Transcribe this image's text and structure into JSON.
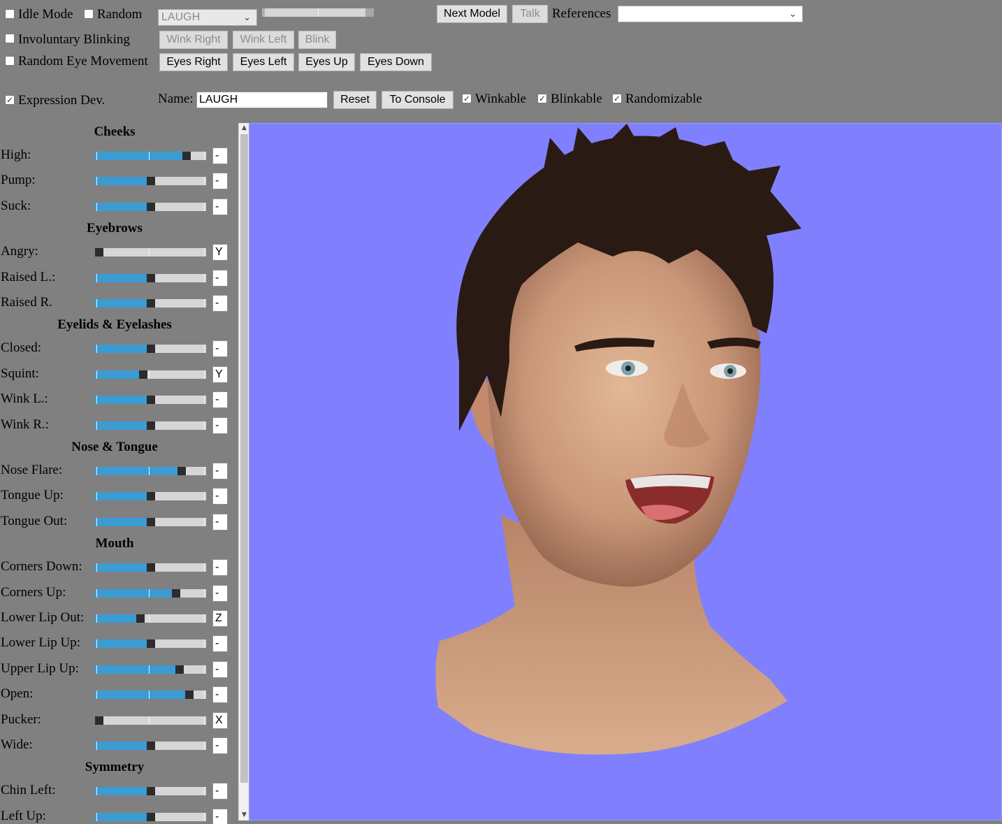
{
  "toolbar": {
    "idle_mode": {
      "label": "Idle Mode",
      "checked": false
    },
    "random": {
      "label": "Random",
      "checked": false
    },
    "expression_select": {
      "value": "LAUGH"
    },
    "next_model": "Next Model",
    "talk": "Talk",
    "references_label": "References",
    "references_value": "",
    "involuntary_blinking": {
      "label": "Involuntary Blinking",
      "checked": false
    },
    "wink_right": "Wink Right",
    "wink_left": "Wink Left",
    "blink": "Blink",
    "random_eye_movement": {
      "label": "Random Eye Movement",
      "checked": false
    },
    "eyes_right": "Eyes Right",
    "eyes_left": "Eyes Left",
    "eyes_up": "Eyes Up",
    "eyes_down": "Eyes Down",
    "expression_dev": {
      "label": "Expression Dev.",
      "checked": true
    },
    "name_label": "Name:",
    "name_value": "LAUGH",
    "reset": "Reset",
    "to_console": "To Console",
    "winkable": {
      "label": "Winkable",
      "checked": true
    },
    "blinkable": {
      "label": "Blinkable",
      "checked": true
    },
    "randomizable": {
      "label": "Randomizable",
      "checked": true
    }
  },
  "sections": [
    {
      "title": "Cheeks",
      "sliders": [
        {
          "label": "High:",
          "value": 0.85,
          "key": "-"
        },
        {
          "label": "Pump:",
          "value": 0.5,
          "key": "-"
        },
        {
          "label": "Suck:",
          "value": 0.5,
          "key": "-"
        }
      ]
    },
    {
      "title": "Eyebrows",
      "sliders": [
        {
          "label": "Angry:",
          "value": 0.0,
          "key": "Y"
        },
        {
          "label": "Raised L.:",
          "value": 0.5,
          "key": "-"
        },
        {
          "label": "Raised R.",
          "value": 0.5,
          "key": "-"
        }
      ]
    },
    {
      "title": "Eyelids & Eyelashes",
      "sliders": [
        {
          "label": "Closed:",
          "value": 0.5,
          "key": "-"
        },
        {
          "label": "Squint:",
          "value": 0.43,
          "key": "Y"
        },
        {
          "label": "Wink L.:",
          "value": 0.5,
          "key": "-"
        },
        {
          "label": "Wink R.:",
          "value": 0.5,
          "key": "-"
        }
      ]
    },
    {
      "title": "Nose & Tongue",
      "sliders": [
        {
          "label": "Nose Flare:",
          "value": 0.8,
          "key": "-"
        },
        {
          "label": "Tongue Up:",
          "value": 0.5,
          "key": "-"
        },
        {
          "label": "Tongue Out:",
          "value": 0.5,
          "key": "-"
        }
      ]
    },
    {
      "title": "Mouth",
      "sliders": [
        {
          "label": "Corners Down:",
          "value": 0.5,
          "key": "-"
        },
        {
          "label": "Corners Up:",
          "value": 0.75,
          "key": "-"
        },
        {
          "label": "Lower Lip Out:",
          "value": 0.4,
          "key": "Z"
        },
        {
          "label": "Lower Lip Up:",
          "value": 0.5,
          "key": "-"
        },
        {
          "label": "Upper Lip Up:",
          "value": 0.78,
          "key": "-"
        },
        {
          "label": "Open:",
          "value": 0.88,
          "key": "-"
        },
        {
          "label": "Pucker:",
          "value": 0.0,
          "key": "X"
        },
        {
          "label": "Wide:",
          "value": 0.5,
          "key": "-"
        }
      ]
    },
    {
      "title": "Symmetry",
      "sliders": [
        {
          "label": "Chin Left:",
          "value": 0.5,
          "key": "-"
        },
        {
          "label": "Left Up:",
          "value": 0.5,
          "key": "-"
        }
      ]
    }
  ],
  "colors": {
    "background": "#808080",
    "viewport": "#8080ff",
    "slider_fill": "#3a9cd3",
    "slider_track": "#d6d6d6",
    "slider_thumb": "#2c2c2c"
  }
}
